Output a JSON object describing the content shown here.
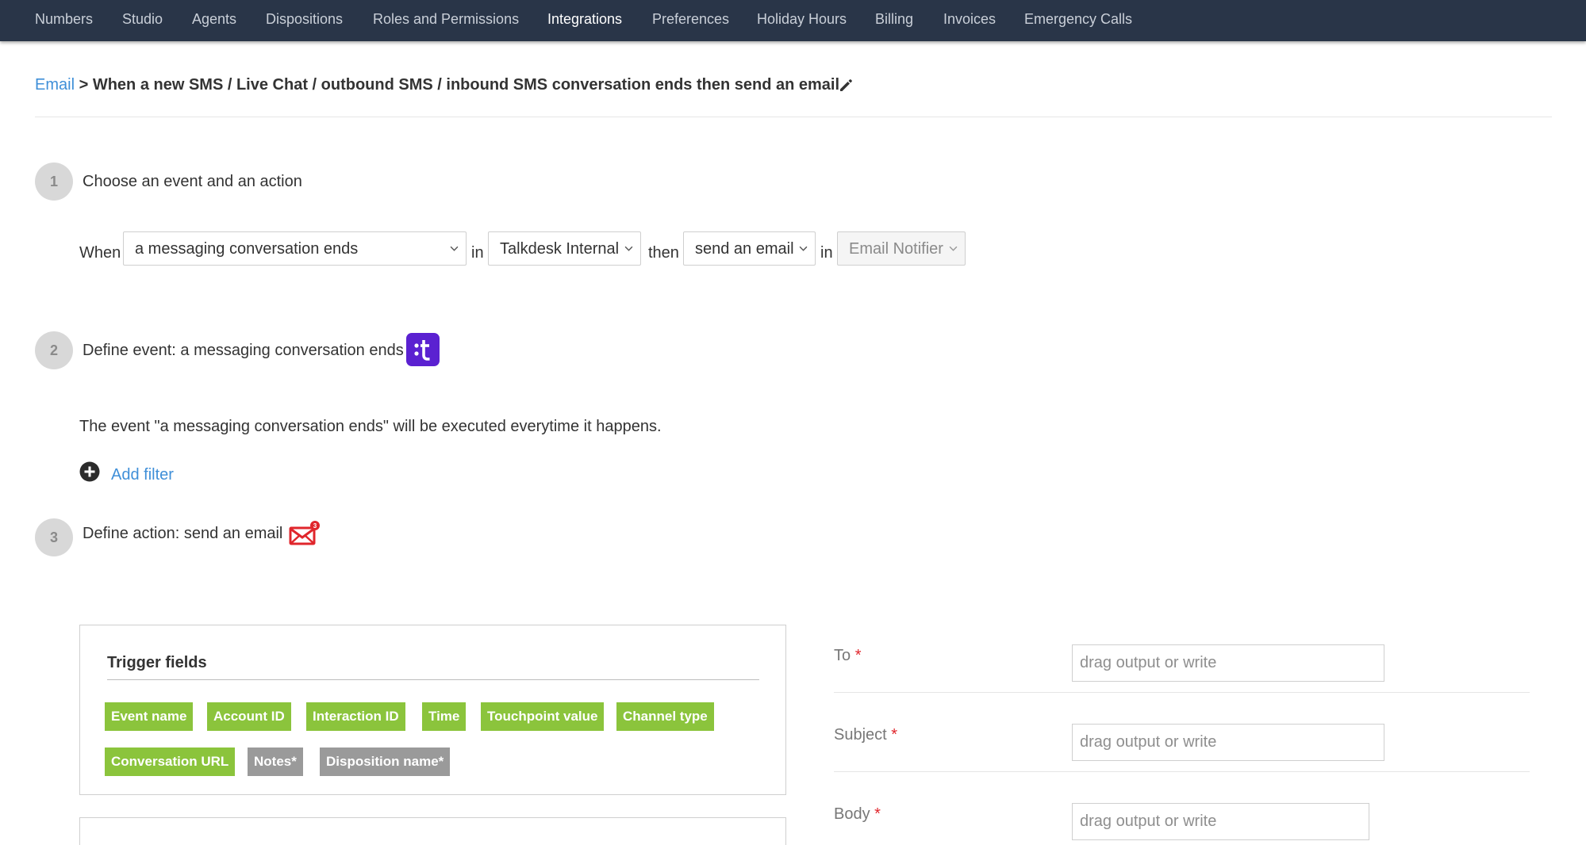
{
  "nav": {
    "items": [
      "Numbers",
      "Studio",
      "Agents",
      "Dispositions",
      "Roles and Permissions",
      "Integrations",
      "Preferences",
      "Holiday Hours",
      "Billing",
      "Invoices",
      "Emergency Calls"
    ],
    "active": "Integrations"
  },
  "breadcrumb": {
    "link": "Email",
    "separator": ">",
    "title": "When a new SMS / Live Chat / outbound SMS / inbound SMS conversation ends then send an email"
  },
  "step1": {
    "number": "1",
    "title": "Choose an event and an action",
    "rule": {
      "when": "When",
      "event": "a messaging conversation ends",
      "in1": "in",
      "source": "Talkdesk Internal",
      "then": "then",
      "action": "send an email",
      "in2": "in",
      "target": "Email Notifier"
    }
  },
  "step2": {
    "number": "2",
    "title": "Define event: a messaging conversation ends",
    "description": "The event \"a messaging conversation ends\" will be executed everytime it happens.",
    "add_filter": "Add filter",
    "logo_icon": "talkdesk-logo-icon"
  },
  "step3": {
    "number": "3",
    "title": "Define action: send an email",
    "icon": "email-notifier-icon",
    "icon_badge": "3"
  },
  "trigger_fields": {
    "title": "Trigger fields",
    "tags": [
      {
        "label": "Event name",
        "type": "green"
      },
      {
        "label": "Account ID",
        "type": "green"
      },
      {
        "label": "Interaction ID",
        "type": "green"
      },
      {
        "label": "Time",
        "type": "green"
      },
      {
        "label": "Touchpoint value",
        "type": "green"
      },
      {
        "label": "Channel type",
        "type": "green"
      },
      {
        "label": "Conversation URL",
        "type": "green"
      },
      {
        "label": "Notes*",
        "type": "grey"
      },
      {
        "label": "Disposition name*",
        "type": "grey"
      }
    ]
  },
  "form": {
    "required_mark": "*",
    "fields": [
      {
        "label": "To",
        "placeholder": "drag output or write"
      },
      {
        "label": "Subject",
        "placeholder": "drag output or write"
      },
      {
        "label": "Body",
        "placeholder": "drag output or write"
      }
    ]
  },
  "colors": {
    "nav_bg": "#293548",
    "link": "#3f8fd8",
    "tag_green": "#8bc43c",
    "tag_grey": "#9a9a9a",
    "brand_purple": "#5b21d1",
    "email_red": "#e0262c",
    "required": "#e0262c"
  }
}
